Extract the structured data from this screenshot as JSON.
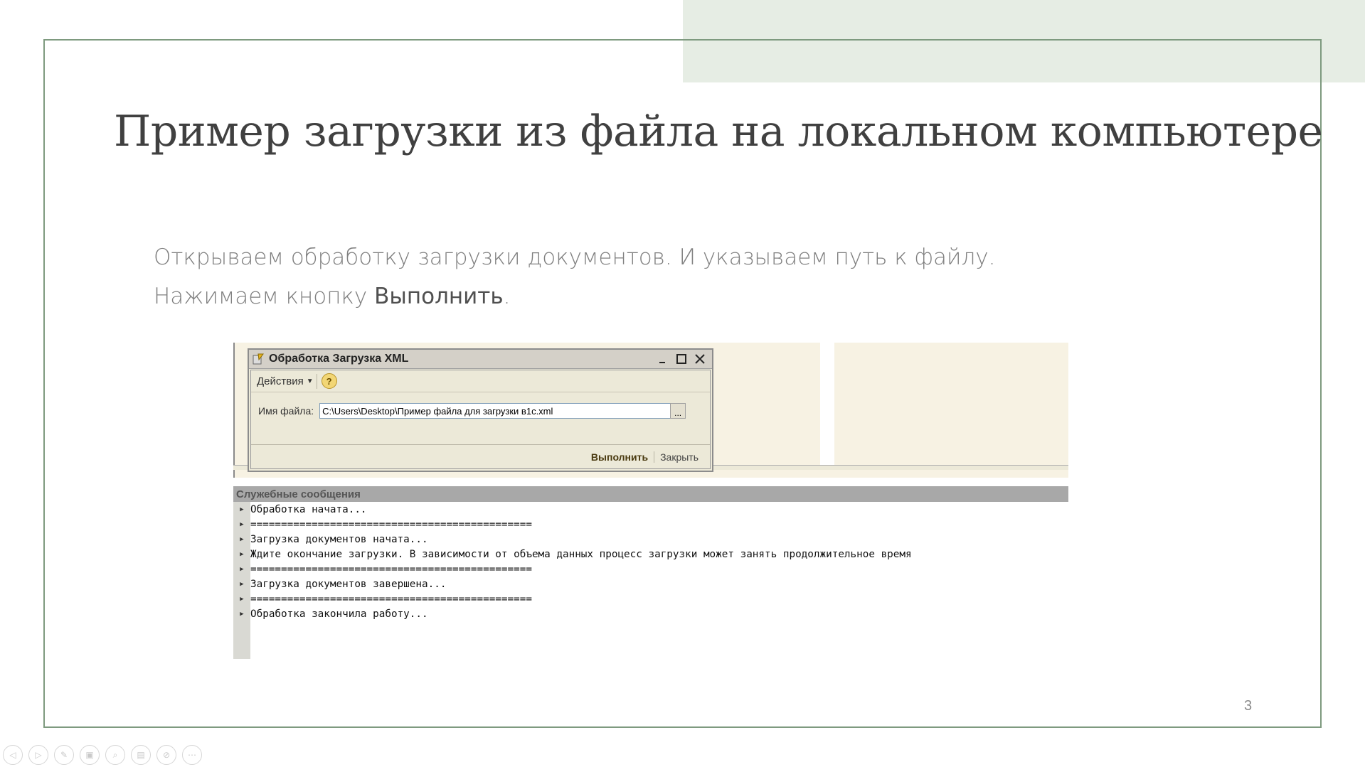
{
  "slide": {
    "title": "Пример загрузки из файла на локальном компьютере",
    "line1": "Открываем обработку загрузки документов. И указываем путь к файлу.",
    "line2_prefix": "Нажимаем кнопку ",
    "line2_emph": "Выполнить",
    "line2_suffix": ".",
    "page_number": "3"
  },
  "dialog": {
    "title": "Обработка  Загрузка XML",
    "actions_label": "Действия",
    "help_label": "?",
    "file_label": "Имя файла:",
    "file_value": "C:\\Users\\Desktop\\Пример файла для загрузки в1с.xml",
    "browse_label": "...",
    "run_label": "Выполнить",
    "close_label": "Закрыть"
  },
  "messages": {
    "header": "Служебные сообщения",
    "rows": [
      "Обработка начата...",
      "==============================================",
      "Загрузка документов начата...",
      "Ждите окончание загрузки. В зависимости от объема данных процесс загрузки может занять продолжительное время",
      "==============================================",
      "Загрузка документов завершена...",
      "==============================================",
      "Обработка закончила работу..."
    ]
  },
  "controls": [
    {
      "icon": "previous-icon"
    },
    {
      "icon": "next-icon"
    },
    {
      "icon": "pen-icon"
    },
    {
      "icon": "slides-icon"
    },
    {
      "icon": "zoom-icon"
    },
    {
      "icon": "subtitles-icon"
    },
    {
      "icon": "camera-off-icon"
    },
    {
      "icon": "more-icon"
    }
  ],
  "colors": {
    "frame": "#7e9a7f",
    "accent_band": "#e6ede4",
    "title_text": "#404040"
  }
}
